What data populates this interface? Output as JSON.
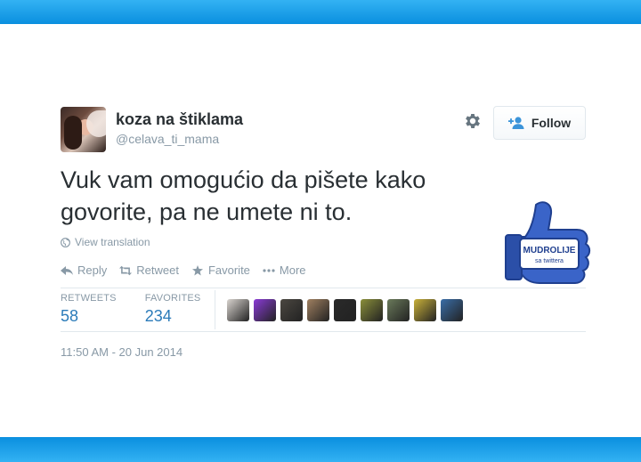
{
  "user": {
    "display_name": "koza na štiklama",
    "handle": "@celava_ti_mama"
  },
  "follow_button": {
    "label": "Follow"
  },
  "tweet": {
    "text": "Vuk vam omogućio da pišete kako govorite, pa ne umete ni to.",
    "translate_label": "View translation",
    "timestamp": "11:50 AM - 20 Jun 2014"
  },
  "actions": {
    "reply": "Reply",
    "retweet": "Retweet",
    "favorite": "Favorite",
    "more": "More"
  },
  "stats": {
    "retweets_label": "RETWEETS",
    "retweets_value": "58",
    "favorites_label": "FAVORITES",
    "favorites_value": "234"
  },
  "favoriters": [
    {
      "color": "#d9d4cf"
    },
    {
      "color": "#8a3bd6"
    },
    {
      "color": "#4b4741"
    },
    {
      "color": "#a08060"
    },
    {
      "color": "#2a2a2a"
    },
    {
      "color": "#8a8f3a"
    },
    {
      "color": "#6a7a5a"
    },
    {
      "color": "#c9b13a"
    },
    {
      "color": "#3a6ea8"
    }
  ],
  "badge": {
    "line1": "MUDROLIJE",
    "line2": "sa twittera"
  },
  "colors": {
    "band": "#0a97e8",
    "link": "#2b7bb9",
    "muted": "#8899a6",
    "badge_blue": "#3a64c8"
  },
  "icons": {
    "gear": "gear-icon",
    "follow": "add-person-icon",
    "globe": "globe-icon",
    "reply": "reply-icon",
    "retweet": "retweet-icon",
    "favorite": "star-icon",
    "more": "ellipsis-icon"
  }
}
